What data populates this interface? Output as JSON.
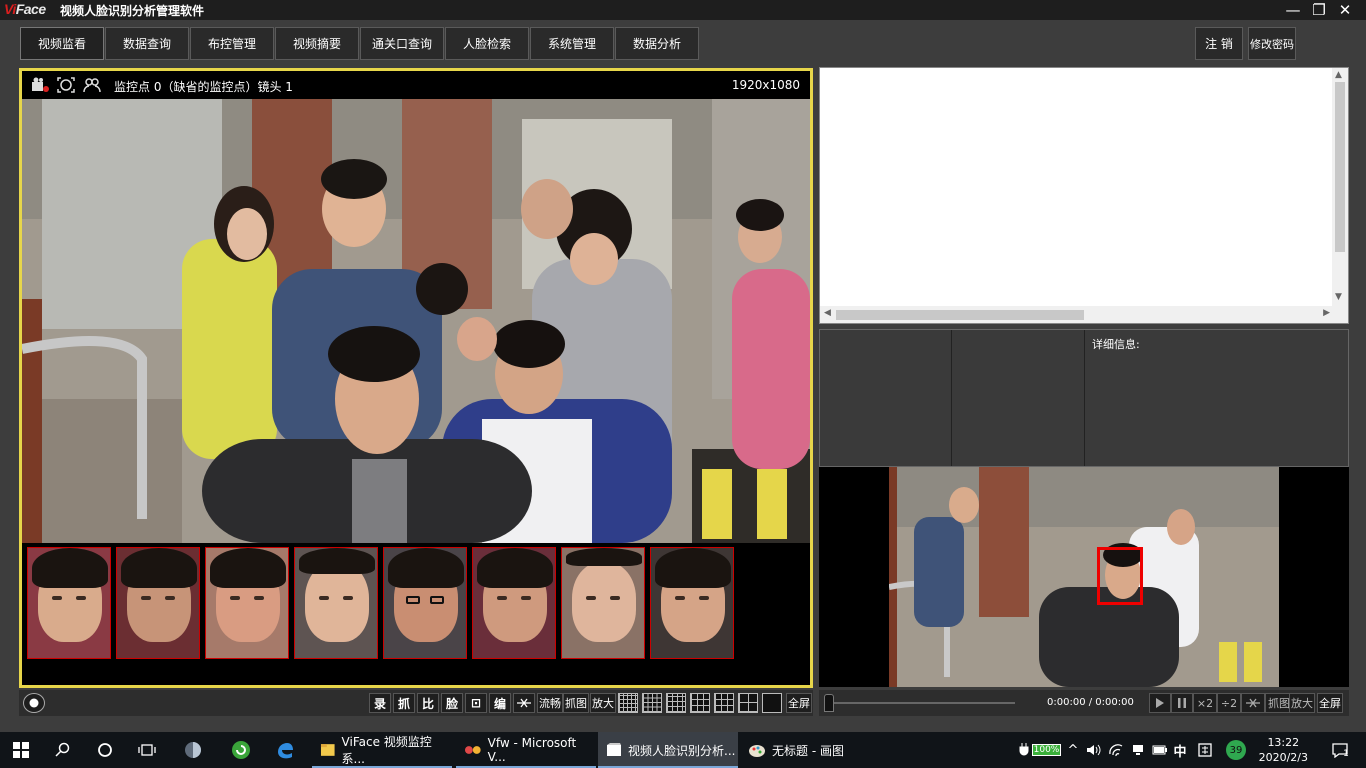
{
  "app": {
    "logo_brand": "Vi",
    "logo_rest": "Face",
    "title": "视频人脸识别分析管理软件"
  },
  "window_controls": {
    "minimize": "—",
    "restore": "❐",
    "close": "✕"
  },
  "menu": {
    "items": [
      "视频监看",
      "数据查询",
      "布控管理",
      "视频摘要",
      "通关口查询",
      "人脸检索",
      "系统管理",
      "数据分析"
    ],
    "active_index": 0,
    "logout": "注 销",
    "change_password": "修改密码"
  },
  "video": {
    "header_text": "监控点 0（缺省的监控点）镜头 1",
    "resolution": "1920x1080",
    "face_thumbnails": 8
  },
  "video_toolbar": {
    "buttons": [
      "录",
      "抓",
      "比",
      "脸",
      "⊡",
      "编"
    ],
    "text_buttons": [
      "流畅",
      "抓图",
      "放大"
    ],
    "fullscreen": "全屏"
  },
  "detail": {
    "label": "详细信息:"
  },
  "playback": {
    "time": "0:00:00 / 0:00:00",
    "buttons": [
      "×2",
      "÷2"
    ],
    "capture": "抓图",
    "zoom": "放大",
    "fullscreen": "全屏"
  },
  "taskbar": {
    "tasks": [
      {
        "label": "ViFace 视频监控系...",
        "active": false
      },
      {
        "label": "Vfw - Microsoft V...",
        "active": false
      },
      {
        "label": "视频人脸识别分析...",
        "active": true
      },
      {
        "label": "无标题 - 画图",
        "active": false
      }
    ],
    "battery": "100%",
    "ime": "中",
    "badge": "39",
    "time": "13:22",
    "date": "2020/2/3",
    "notifications": "1"
  }
}
